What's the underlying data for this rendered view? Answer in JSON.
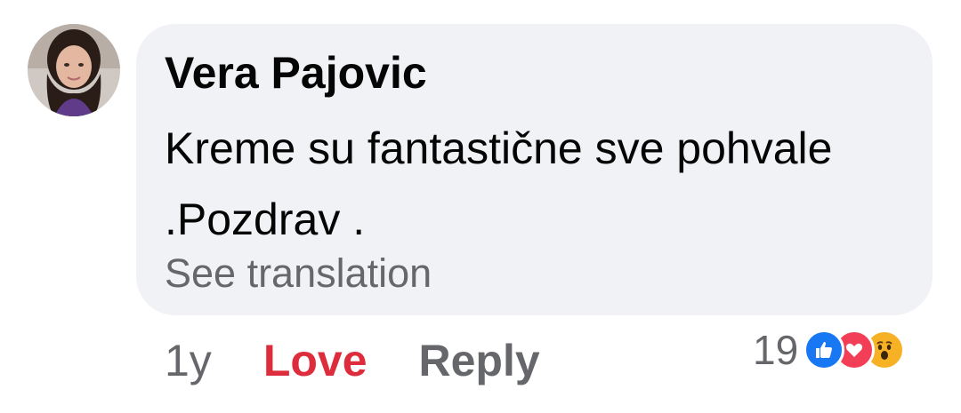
{
  "comment": {
    "author": "Vera Pajovic",
    "text": "Kreme su fantastične sve pohvale .Pozdrav .",
    "see_translation": "See translation"
  },
  "actions": {
    "time": "1y",
    "love": "Love",
    "reply": "Reply"
  },
  "reactions": {
    "count": "19",
    "icons": [
      "like-icon",
      "love-icon",
      "wow-icon"
    ]
  },
  "colors": {
    "bubble_bg": "#f0f2f5",
    "love_active": "#dd2c3b",
    "muted": "#65676b",
    "like_blue": "#1877f2",
    "love_red": "#f33e58",
    "wow_yellow": "#f7b125"
  }
}
